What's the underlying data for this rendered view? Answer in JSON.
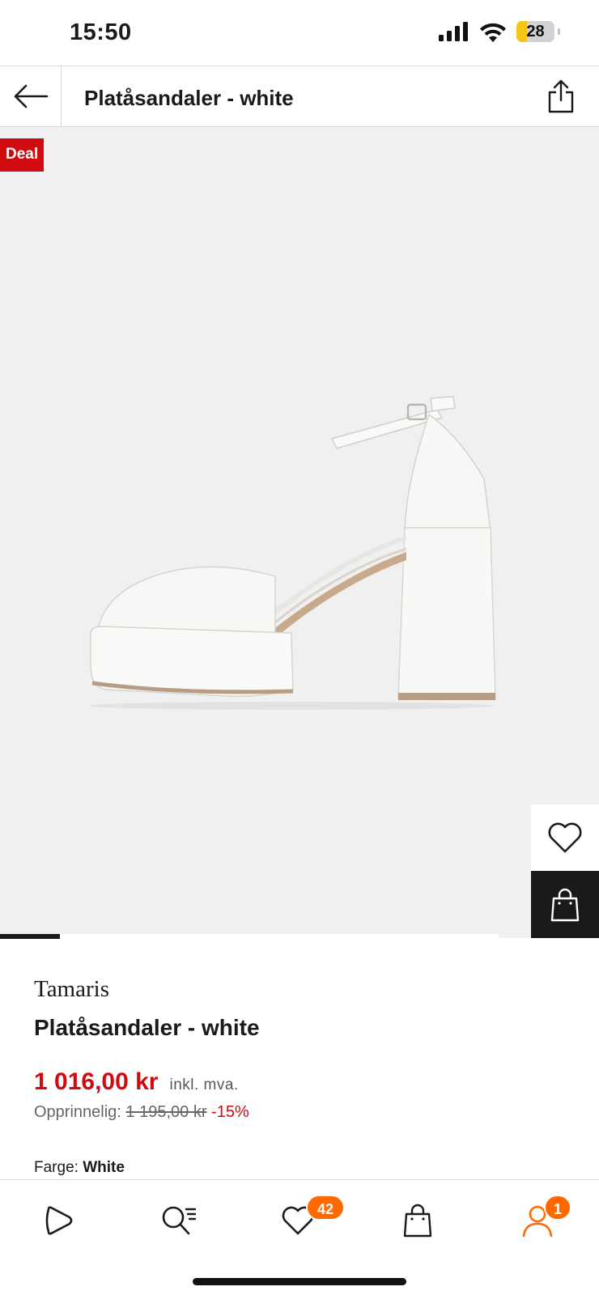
{
  "status_bar": {
    "time": "15:50",
    "battery_level": "28",
    "battery_color": "#f5c518",
    "icons": [
      "cellular-signal-icon",
      "wifi-icon",
      "battery-icon"
    ]
  },
  "header": {
    "title": "Platåsandaler - white",
    "back_icon": "arrow-left-icon",
    "share_icon": "share-icon"
  },
  "product_image": {
    "deal_badge": "Deal",
    "deal_color": "#d10a10",
    "carousel_progress": 0.12,
    "actions": [
      "heart-icon",
      "shopping-bag-icon"
    ]
  },
  "product": {
    "brand": "Tamaris",
    "title": "Platåsandaler - white",
    "price": "1 016,00 kr",
    "vat_note": "inkl. mva.",
    "original_label": "Opprinnelig:",
    "original_price": "1 195,00 kr",
    "discount": "-15%",
    "color_label": "Farge:",
    "color_value": "White",
    "price_color": "#d10a10"
  },
  "bottom_nav": {
    "items": [
      {
        "name": "home",
        "icon": "play-home-icon"
      },
      {
        "name": "search",
        "icon": "search-list-icon"
      },
      {
        "name": "wishlist",
        "icon": "heart-icon",
        "badge": "42"
      },
      {
        "name": "bag",
        "icon": "shopping-bag-icon"
      },
      {
        "name": "profile",
        "icon": "user-icon",
        "badge": "1"
      }
    ],
    "badge_color": "#ff6900",
    "active_color": "#ff6900"
  }
}
